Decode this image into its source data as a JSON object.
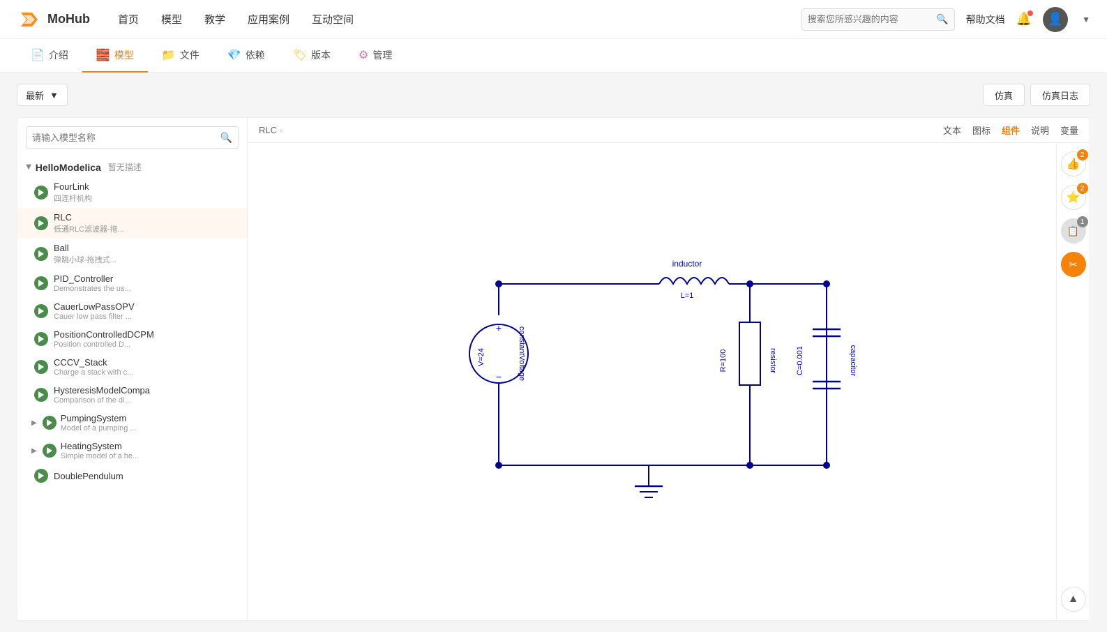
{
  "app": {
    "logo_text": "MoHub",
    "nav_links": [
      "首页",
      "模型",
      "教学",
      "应用案例",
      "互动空间"
    ],
    "search_placeholder": "搜索您所感兴趣的内容",
    "help_doc": "帮助文档",
    "sub_tabs": [
      {
        "label": "介绍",
        "icon": "📄",
        "active": false
      },
      {
        "label": "模型",
        "icon": "🧱",
        "active": true
      },
      {
        "label": "文件",
        "icon": "📁",
        "active": false
      },
      {
        "label": "依赖",
        "icon": "💎",
        "active": false
      },
      {
        "label": "版本",
        "icon": "🏷",
        "active": false
      },
      {
        "label": "管理",
        "icon": "⚙",
        "active": false
      }
    ]
  },
  "toolbar": {
    "sort_label": "最新",
    "simulate_btn": "仿真",
    "simulate_log_btn": "仿真日志"
  },
  "sidebar": {
    "search_placeholder": "请输入模型名称",
    "models": [
      {
        "name": "HelloModelica",
        "desc": "暂无描述",
        "type": "group",
        "expanded": true
      },
      {
        "name": "FourLink",
        "desc": "四连杆机构",
        "active": false
      },
      {
        "name": "RLC",
        "desc": "低通RLC滤波器-拖...",
        "active": true
      },
      {
        "name": "Ball",
        "desc": "弹跳小球-拖拽式...",
        "active": false
      },
      {
        "name": "PID_Controller",
        "desc": "Demonstrates the us...",
        "active": false
      },
      {
        "name": "CauerLowPassOPV",
        "desc": "Cauer low pass filter ...",
        "active": false
      },
      {
        "name": "PositionControlledDCPM",
        "desc": "Position controlled D...",
        "active": false
      },
      {
        "name": "CCCV_Stack",
        "desc": "Charge a stack with c...",
        "active": false
      },
      {
        "name": "HysteresisModelCompa",
        "desc": "Comparison of the di...",
        "active": false
      },
      {
        "name": "PumpingSystem",
        "desc": "Model of a pumping ...",
        "active": false,
        "has_sub": true
      },
      {
        "name": "HeatingSystem",
        "desc": "Simple model of a he...",
        "active": false,
        "has_sub": true
      },
      {
        "name": "DoublePendulum",
        "desc": "",
        "active": false
      }
    ]
  },
  "canvas": {
    "breadcrumb": "RLC",
    "tabs": [
      {
        "label": "文本",
        "active": false
      },
      {
        "label": "图标",
        "active": false
      },
      {
        "label": "组件",
        "active": true
      },
      {
        "label": "说明",
        "active": false
      },
      {
        "label": "变量",
        "active": false
      }
    ],
    "circuit": {
      "inductor_label": "inductor",
      "inductor_value": "L=1",
      "voltage_label": "constantVoltage",
      "voltage_value": "V=24",
      "resistor_label": "resistor",
      "resistor_value": "R=100",
      "capacitor_label": "capacitor",
      "capacitor_value": "C=0.001"
    }
  },
  "right_actions": [
    {
      "icon": "👍",
      "badge": "2",
      "type": "normal"
    },
    {
      "icon": "⭐",
      "badge": "2",
      "type": "normal"
    },
    {
      "icon": "📋",
      "badge": "1",
      "type": "gray"
    },
    {
      "icon": "✂",
      "badge": null,
      "type": "orange"
    },
    {
      "icon": "▲",
      "badge": null,
      "type": "normal"
    }
  ]
}
